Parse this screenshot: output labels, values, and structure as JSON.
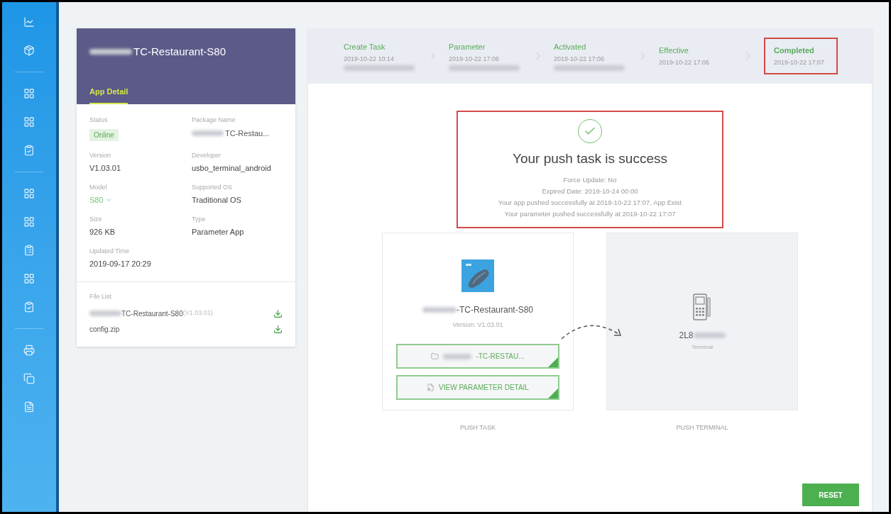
{
  "app_card": {
    "title": "TC-Restaurant-S80",
    "title_blurred": true,
    "tab": {
      "label": "App Detail",
      "selected": true
    },
    "fields": [
      {
        "label": "Status",
        "value": "Online",
        "kind": "badge"
      },
      {
        "label": "Package Name",
        "value": "TC-Restau...",
        "kind": "blurred"
      },
      {
        "label": "Version",
        "value": "V1.03.01",
        "kind": "text"
      },
      {
        "label": "Developer",
        "value": "usbo_terminal_android",
        "kind": "text"
      },
      {
        "label": "Model",
        "value": "S80",
        "kind": "dropdown"
      },
      {
        "label": "Supported OS",
        "value": "Traditional OS",
        "kind": "text"
      },
      {
        "label": "Size",
        "value": "926 KB",
        "kind": "text"
      },
      {
        "label": "Type",
        "value": "Parameter App",
        "kind": "text"
      },
      {
        "label": "Updated Time",
        "value": "2019-09-17 20:29",
        "kind": "text"
      }
    ],
    "file_list": {
      "label": "File List",
      "files": [
        {
          "name": "TC-Restaurant-S80",
          "version": "(V1.03.01)",
          "blurred": true
        },
        {
          "name": "config.zip",
          "blurred": false
        }
      ]
    }
  },
  "steps": [
    {
      "label": "Create Task",
      "time": "2019-10-22 10:14",
      "blurred_note": true,
      "selected": false
    },
    {
      "label": "Parameter",
      "time": "2019-10-22 17:06",
      "blurred_note": true,
      "selected": false
    },
    {
      "label": "Activated",
      "time": "2019-10-22 17:06",
      "blurred_note": true,
      "selected": false
    },
    {
      "label": "Effective",
      "time": "2019-10-22 17:06",
      "blurred_note": false,
      "selected": false
    },
    {
      "label": "Completed",
      "time": "2019-10-22 17:07",
      "blurred_note": false,
      "selected": true
    }
  ],
  "result": {
    "title": "Your push task is success",
    "lines": [
      "Force Update: No",
      "Expired Date: 2019-10-24 00:00",
      "Your app pushed successfully at 2019-10-22 17:07, App Exist",
      "Your parameter pushed successfully at 2019-10-22 17:07"
    ]
  },
  "push_task": {
    "app_name": "-TC-Restaurant-S80",
    "version": "Version: V1.03.01",
    "buttons": [
      {
        "label": "-TC-RESTAU...",
        "kind": "file"
      },
      {
        "label": "VIEW PARAMETER DETAIL",
        "kind": "params"
      }
    ],
    "caption": "PUSH TASK"
  },
  "push_terminal": {
    "serial": "2L8",
    "type": "Terminal",
    "caption": "PUSH TERMINAL"
  },
  "reset_button": "RESET"
}
